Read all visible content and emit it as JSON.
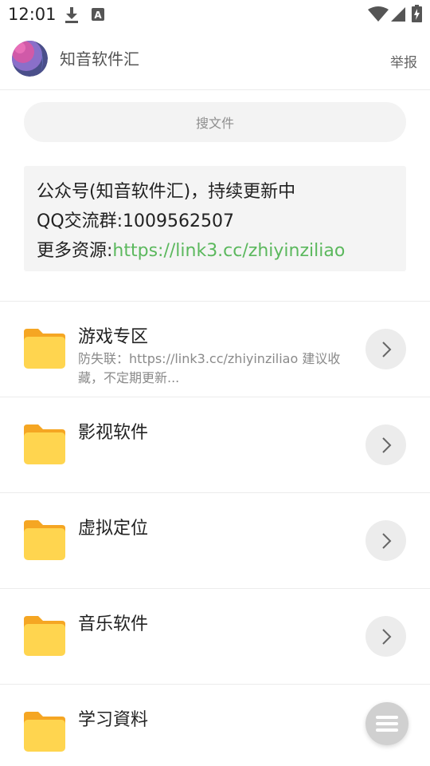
{
  "status_bar": {
    "time": "12:01",
    "icons": [
      "download-icon",
      "app-notification-icon",
      "wifi-icon",
      "signal-icon",
      "battery-icon"
    ]
  },
  "header": {
    "title": "知音软件汇",
    "report_label": "举报"
  },
  "search": {
    "placeholder": "搜文件"
  },
  "notice": {
    "line1": "公众号(知音软件汇)，持续更新中",
    "line2": "QQ交流群:1009562507",
    "line3_prefix": "更多资源:",
    "line3_link": "https://link3.cc/zhiyinziliao"
  },
  "folders": [
    {
      "name": "游戏专区",
      "description": "防失联：https://link3.cc/zhiyinziliao 建议收藏，不定期更新..."
    },
    {
      "name": "影视软件",
      "description": ""
    },
    {
      "name": "虚拟定位",
      "description": ""
    },
    {
      "name": "音乐软件",
      "description": ""
    },
    {
      "name": "学习資料",
      "description": ""
    }
  ],
  "colors": {
    "link": "#5bb85d",
    "folder_front": "#ffd54f",
    "folder_back": "#f5a623"
  }
}
